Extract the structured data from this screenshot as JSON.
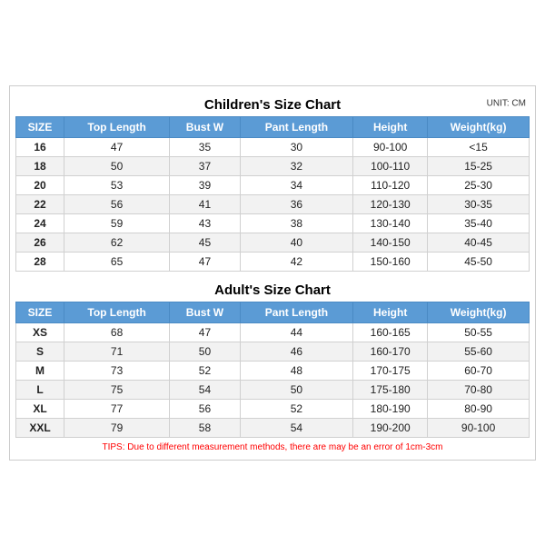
{
  "children_title": "Children's Size Chart",
  "adult_title": "Adult's Size Chart",
  "unit_label": "UNIT: CM",
  "columns": [
    "SIZE",
    "Top Length",
    "Bust W",
    "Pant Length",
    "Height",
    "Weight(kg)"
  ],
  "children_rows": [
    [
      "16",
      "47",
      "35",
      "30",
      "90-100",
      "<15"
    ],
    [
      "18",
      "50",
      "37",
      "32",
      "100-110",
      "15-25"
    ],
    [
      "20",
      "53",
      "39",
      "34",
      "110-120",
      "25-30"
    ],
    [
      "22",
      "56",
      "41",
      "36",
      "120-130",
      "30-35"
    ],
    [
      "24",
      "59",
      "43",
      "38",
      "130-140",
      "35-40"
    ],
    [
      "26",
      "62",
      "45",
      "40",
      "140-150",
      "40-45"
    ],
    [
      "28",
      "65",
      "47",
      "42",
      "150-160",
      "45-50"
    ]
  ],
  "adult_rows": [
    [
      "XS",
      "68",
      "47",
      "44",
      "160-165",
      "50-55"
    ],
    [
      "S",
      "71",
      "50",
      "46",
      "160-170",
      "55-60"
    ],
    [
      "M",
      "73",
      "52",
      "48",
      "170-175",
      "60-70"
    ],
    [
      "L",
      "75",
      "54",
      "50",
      "175-180",
      "70-80"
    ],
    [
      "XL",
      "77",
      "56",
      "52",
      "180-190",
      "80-90"
    ],
    [
      "XXL",
      "79",
      "58",
      "54",
      "190-200",
      "90-100"
    ]
  ],
  "tips": "TIPS: Due to different measurement methods, there are may be an error of 1cm-3cm"
}
